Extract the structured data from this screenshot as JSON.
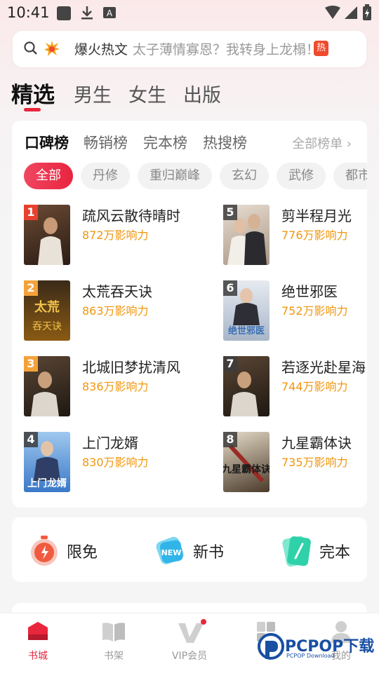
{
  "status_bar": {
    "time": "10:41"
  },
  "search": {
    "hot_label": "爆火热文",
    "hint": "太子薄情寡恩？我转身上龙榻！",
    "hot_badge": "热"
  },
  "top_tabs": [
    {
      "label": "精选",
      "active": true
    },
    {
      "label": "男生",
      "active": false
    },
    {
      "label": "女生",
      "active": false
    },
    {
      "label": "出版",
      "active": false
    }
  ],
  "rank": {
    "tabs": [
      {
        "label": "口碑榜",
        "active": true
      },
      {
        "label": "畅销榜",
        "active": false
      },
      {
        "label": "完本榜",
        "active": false
      },
      {
        "label": "热搜榜",
        "active": false
      }
    ],
    "all_list_label": "全部榜单 ›",
    "chips": [
      {
        "label": "全部",
        "active": true
      },
      {
        "label": "丹修",
        "active": false
      },
      {
        "label": "重归巅峰",
        "active": false
      },
      {
        "label": "玄幻",
        "active": false
      },
      {
        "label": "武修",
        "active": false
      },
      {
        "label": "都市",
        "active": false
      }
    ],
    "books": [
      {
        "rank": "1",
        "title": "疏风云散待晴时",
        "influence": "872万影响力"
      },
      {
        "rank": "2",
        "title": "太荒吞天诀",
        "influence": "863万影响力"
      },
      {
        "rank": "3",
        "title": "北城旧梦扰清风",
        "influence": "836万影响力"
      },
      {
        "rank": "4",
        "title": "上门龙婿",
        "influence": "830万影响力"
      },
      {
        "rank": "5",
        "title": "剪半程月光",
        "influence": "776万影响力"
      },
      {
        "rank": "6",
        "title": "绝世邪医",
        "influence": "752万影响力"
      },
      {
        "rank": "7",
        "title": "若逐光赴星海",
        "influence": "744万影响力"
      },
      {
        "rank": "8",
        "title": "九星霸体诀",
        "influence": "735万影响力"
      }
    ]
  },
  "quick_links": [
    {
      "label": "限免",
      "icon": "stopwatch-icon"
    },
    {
      "label": "新书",
      "icon": "new-tag-icon"
    },
    {
      "label": "完本",
      "icon": "finished-book-icon"
    }
  ],
  "bottom_nav": [
    {
      "label": "书城",
      "icon": "bookstore-icon",
      "active": true
    },
    {
      "label": "书架",
      "icon": "bookshelf-icon",
      "active": false
    },
    {
      "label": "VIP会员",
      "icon": "vip-icon",
      "active": false
    },
    {
      "label": "",
      "icon": "category-icon",
      "active": false
    },
    {
      "label": "我的",
      "icon": "profile-icon",
      "active": false
    }
  ],
  "watermark": {
    "brand": "PCPOP下载",
    "sub": "PCPOP Download"
  },
  "colors": {
    "accent": "#e8263c",
    "influence": "#f0960e",
    "rank_badge": "#f3a23a"
  }
}
